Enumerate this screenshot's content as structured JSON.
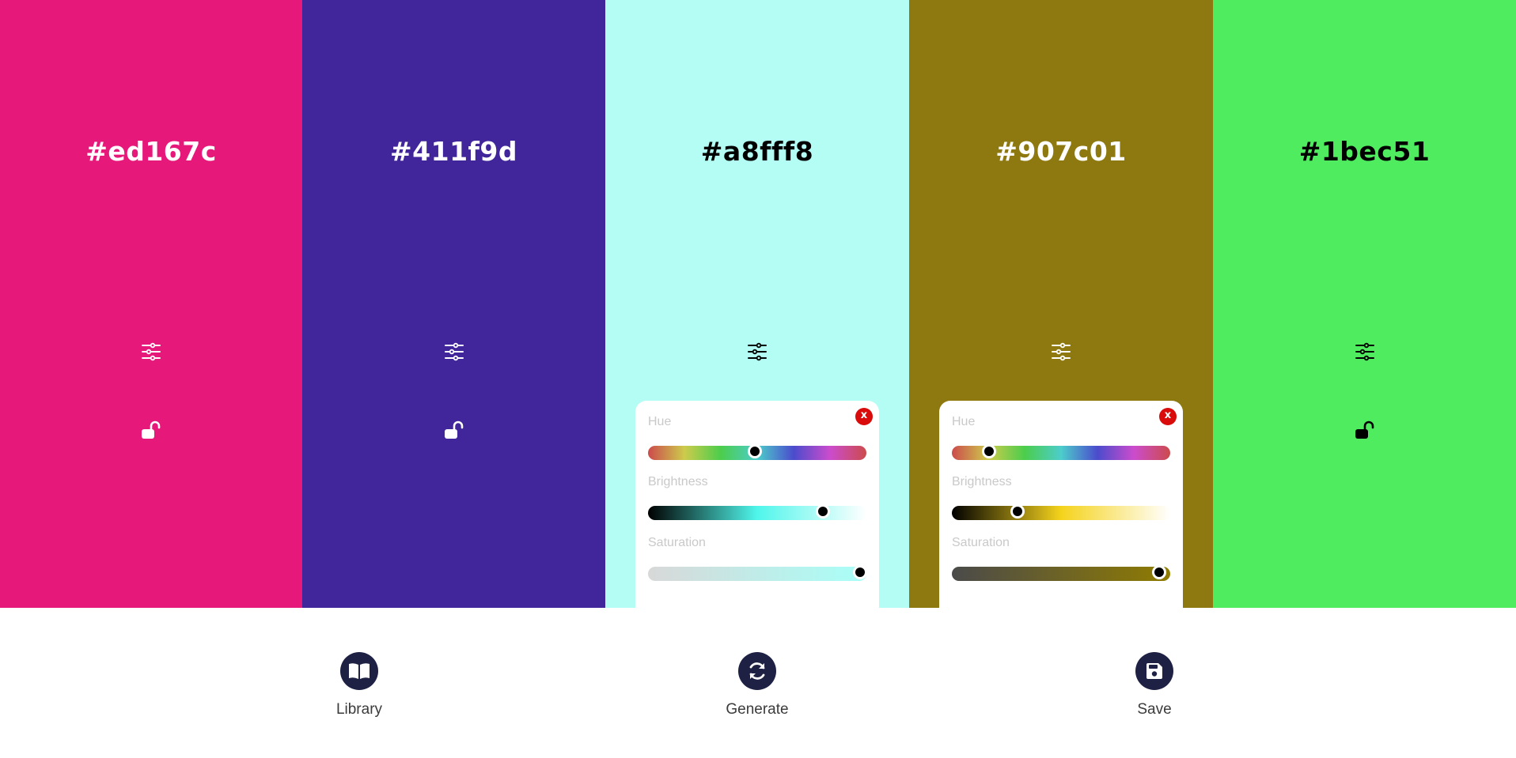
{
  "palette": [
    {
      "hex": "#ed167c",
      "text_color": "#ffffff"
    },
    {
      "hex": "#411f9d",
      "text_color": "#ffffff"
    },
    {
      "hex": "#a8fff8",
      "text_color": "#000000"
    },
    {
      "hex": "#907c01",
      "text_color": "#ffffff"
    },
    {
      "hex": "#1bec51",
      "text_color": "#000000"
    }
  ],
  "swatch_fill": [
    "#e6187a",
    "#41259a",
    "#b3fdf5",
    "#8d790f",
    "#4fec5f"
  ],
  "panels": [
    {
      "close_label": "x",
      "hue_label": "Hue",
      "brightness_label": "Brightness",
      "saturation_label": "Saturation",
      "hue_value": 0.49,
      "brightness_value": 0.8,
      "saturation_value": 0.97,
      "brightness_gradient": [
        "#000000",
        "#4ff6eb",
        "#ffffff"
      ],
      "saturation_gradient": [
        "#d8d8d8",
        "#a8fff8"
      ]
    },
    {
      "close_label": "x",
      "hue_label": "Hue",
      "brightness_label": "Brightness",
      "saturation_label": "Saturation",
      "hue_value": 0.17,
      "brightness_value": 0.3,
      "saturation_value": 0.95,
      "brightness_gradient": [
        "#000000",
        "#f5d31c",
        "#ffffff"
      ],
      "saturation_gradient": [
        "#4a4a4a",
        "#907c01"
      ]
    }
  ],
  "toolbar": {
    "library_label": "Library",
    "generate_label": "Generate",
    "save_label": "Save"
  },
  "icons": {
    "adjust": "sliders-icon",
    "lock": "unlocked-padlock-icon",
    "library": "open-book-icon",
    "generate": "refresh-icon",
    "save": "floppy-disk-icon",
    "close": "close-icon"
  }
}
